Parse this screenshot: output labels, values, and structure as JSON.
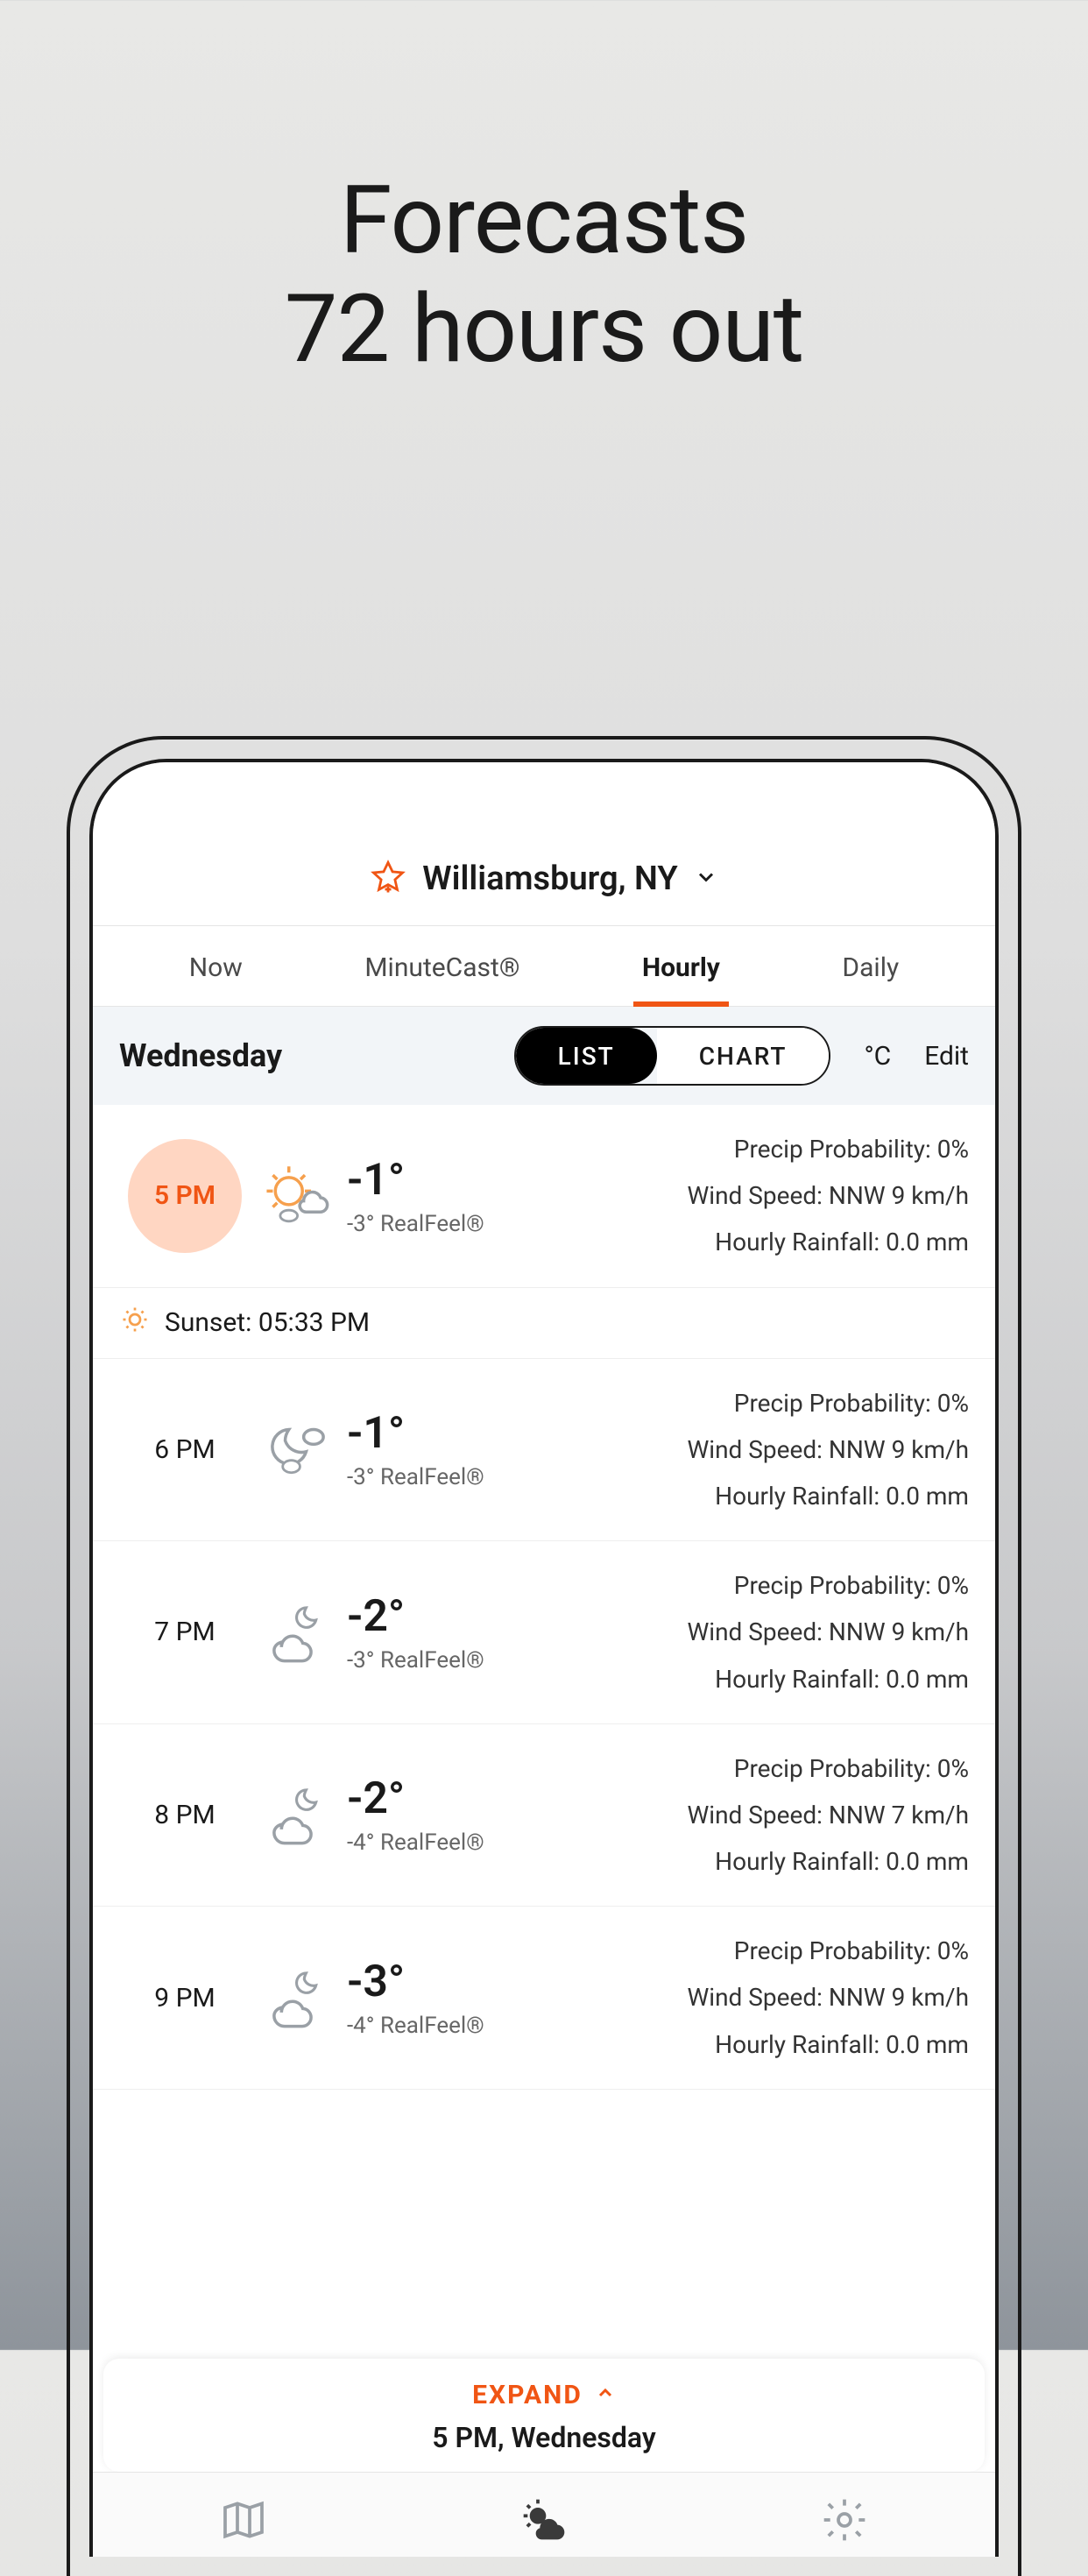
{
  "promo": {
    "line1": "Forecasts",
    "line2": "72 hours out"
  },
  "location": "Williamsburg, NY",
  "tabs": [
    "Now",
    "MinuteCast®",
    "Hourly",
    "Daily"
  ],
  "active_tab": "Hourly",
  "controls": {
    "day": "Wednesday",
    "toggle_list": "LIST",
    "toggle_chart": "CHART",
    "unit": "°C",
    "edit": "Edit"
  },
  "sunset": "Sunset: 05:33 PM",
  "labels": {
    "precip": "Precip Probability:",
    "wind": "Wind Speed:",
    "rain": "Hourly Rainfall:"
  },
  "hours": [
    {
      "time": "5 PM",
      "highlight": true,
      "icon": "sun-cloud",
      "temp": "-1°",
      "feel": "-3° RealFeel®",
      "precip": "0%",
      "wind": "NNW 9 km/h",
      "rain": "0.0 mm"
    },
    {
      "time": "6 PM",
      "highlight": false,
      "icon": "moon-cloud",
      "temp": "-1°",
      "feel": "-3° RealFeel®",
      "precip": "0%",
      "wind": "NNW 9 km/h",
      "rain": "0.0 mm"
    },
    {
      "time": "7 PM",
      "highlight": false,
      "icon": "cloud-moon",
      "temp": "-2°",
      "feel": "-3° RealFeel®",
      "precip": "0%",
      "wind": "NNW 9 km/h",
      "rain": "0.0 mm"
    },
    {
      "time": "8 PM",
      "highlight": false,
      "icon": "cloud-moon",
      "temp": "-2°",
      "feel": "-4° RealFeel®",
      "precip": "0%",
      "wind": "NNW 7 km/h",
      "rain": "0.0 mm"
    },
    {
      "time": "9 PM",
      "highlight": false,
      "icon": "cloud-moon",
      "temp": "-3°",
      "feel": "-4° RealFeel®",
      "precip": "0%",
      "wind": "NNW 9 km/h",
      "rain": "0.0 mm"
    }
  ],
  "expand": {
    "label": "EXPAND",
    "sub": "5 PM,  Wednesday"
  },
  "colors": {
    "accent": "#f05514"
  }
}
